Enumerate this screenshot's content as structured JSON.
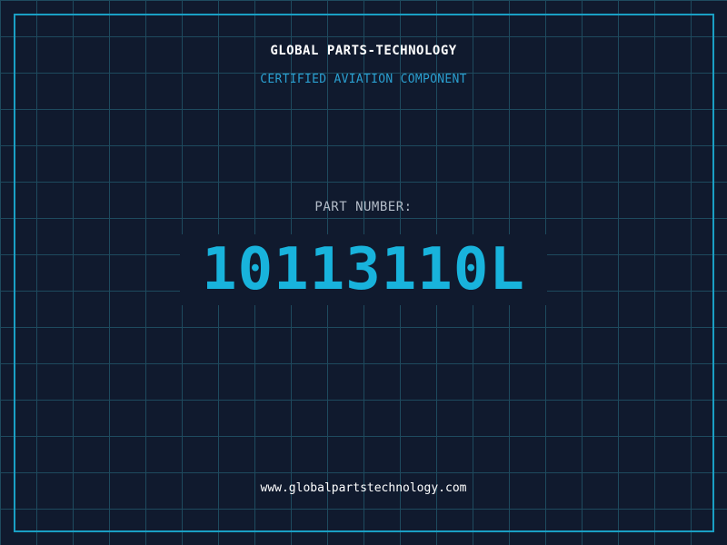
{
  "header": {
    "brand": "GLOBAL PARTS-TECHNOLOGY",
    "subtitle": "CERTIFIED AVIATION COMPONENT"
  },
  "part": {
    "label": "PART NUMBER:",
    "number": "10113110L"
  },
  "footer": {
    "url": "www.globalpartstechnology.com"
  },
  "colors": {
    "background": "#101a2e",
    "grid": "#1e4a5e",
    "frame": "#1a9fc4",
    "accent": "#18b3dc",
    "subtitle": "#2a9fd0",
    "label": "#b3bcc8",
    "text": "#ffffff"
  }
}
